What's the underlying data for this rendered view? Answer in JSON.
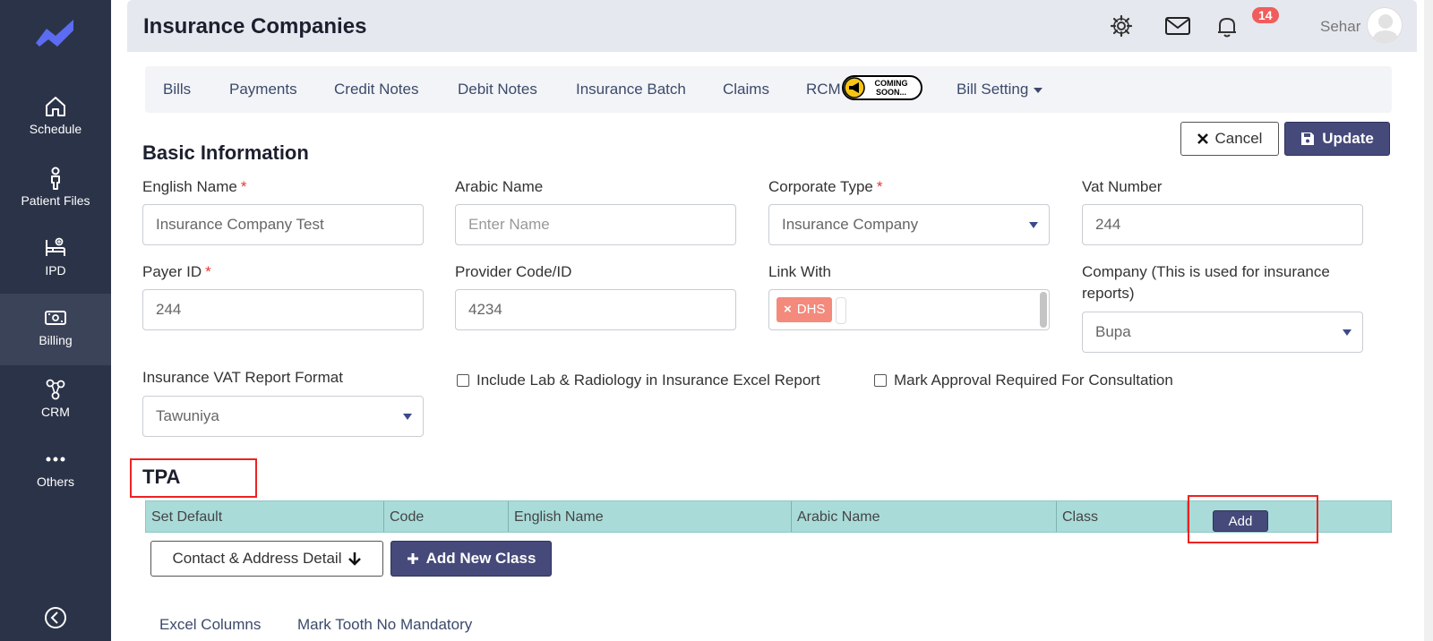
{
  "sidebar": {
    "items": [
      {
        "label": "Schedule"
      },
      {
        "label": "Patient Files"
      },
      {
        "label": "IPD"
      },
      {
        "label": "Billing"
      },
      {
        "label": "CRM"
      },
      {
        "label": "Others"
      }
    ]
  },
  "header": {
    "title": "Insurance Companies",
    "notification_count": "14",
    "user_name": "Sehar"
  },
  "tabs": [
    {
      "label": "Bills"
    },
    {
      "label": "Payments"
    },
    {
      "label": "Credit Notes"
    },
    {
      "label": "Debit Notes"
    },
    {
      "label": "Insurance Batch"
    },
    {
      "label": "Claims"
    },
    {
      "label": "RCM"
    },
    {
      "label": "Bill Setting"
    }
  ],
  "coming_soon": {
    "line1": "COMING",
    "line2": "SOON..."
  },
  "actions": {
    "cancel": "Cancel",
    "update": "Update"
  },
  "basic_info": {
    "title": "Basic Information",
    "english_name": {
      "label": "English Name",
      "value": "Insurance Company Test"
    },
    "arabic_name": {
      "label": "Arabic Name",
      "placeholder": "Enter Name"
    },
    "corporate_type": {
      "label": "Corporate Type",
      "value": "Insurance Company"
    },
    "vat_number": {
      "label": "Vat Number",
      "value": "244"
    },
    "payer_id": {
      "label": "Payer ID",
      "value": "244"
    },
    "provider_code": {
      "label": "Provider Code/ID",
      "value": "4234"
    },
    "link_with": {
      "label": "Link With",
      "chip": "DHS"
    },
    "company": {
      "label_line1": "Company (This is used for insurance",
      "label_line2": "reports)",
      "value": "Bupa"
    },
    "vat_report_format": {
      "label": "Insurance VAT Report Format",
      "value": "Tawuniya"
    },
    "include_lab": {
      "label": "Include Lab & Radiology in Insurance Excel Report"
    },
    "mark_approval": {
      "label": "Mark Approval Required For Consultation"
    }
  },
  "tpa": {
    "title": "TPA",
    "columns": [
      "Set Default",
      "Code",
      "English Name",
      "Arabic Name",
      "Class"
    ],
    "add_label": "Add"
  },
  "buttons": {
    "contact_address": "Contact & Address Detail",
    "add_new_class": "Add New Class"
  },
  "bottom_tabs": [
    {
      "label": "Excel Columns"
    },
    {
      "label": "Mark Tooth No Mandatory"
    }
  ],
  "colors": {
    "sidebar_bg": "#2b3348",
    "primary_button": "#454a7a",
    "table_header_bg": "#a9dbd9",
    "badge": "#ef5d5d",
    "chip": "#f38a7c",
    "highlight": "#e22222"
  }
}
